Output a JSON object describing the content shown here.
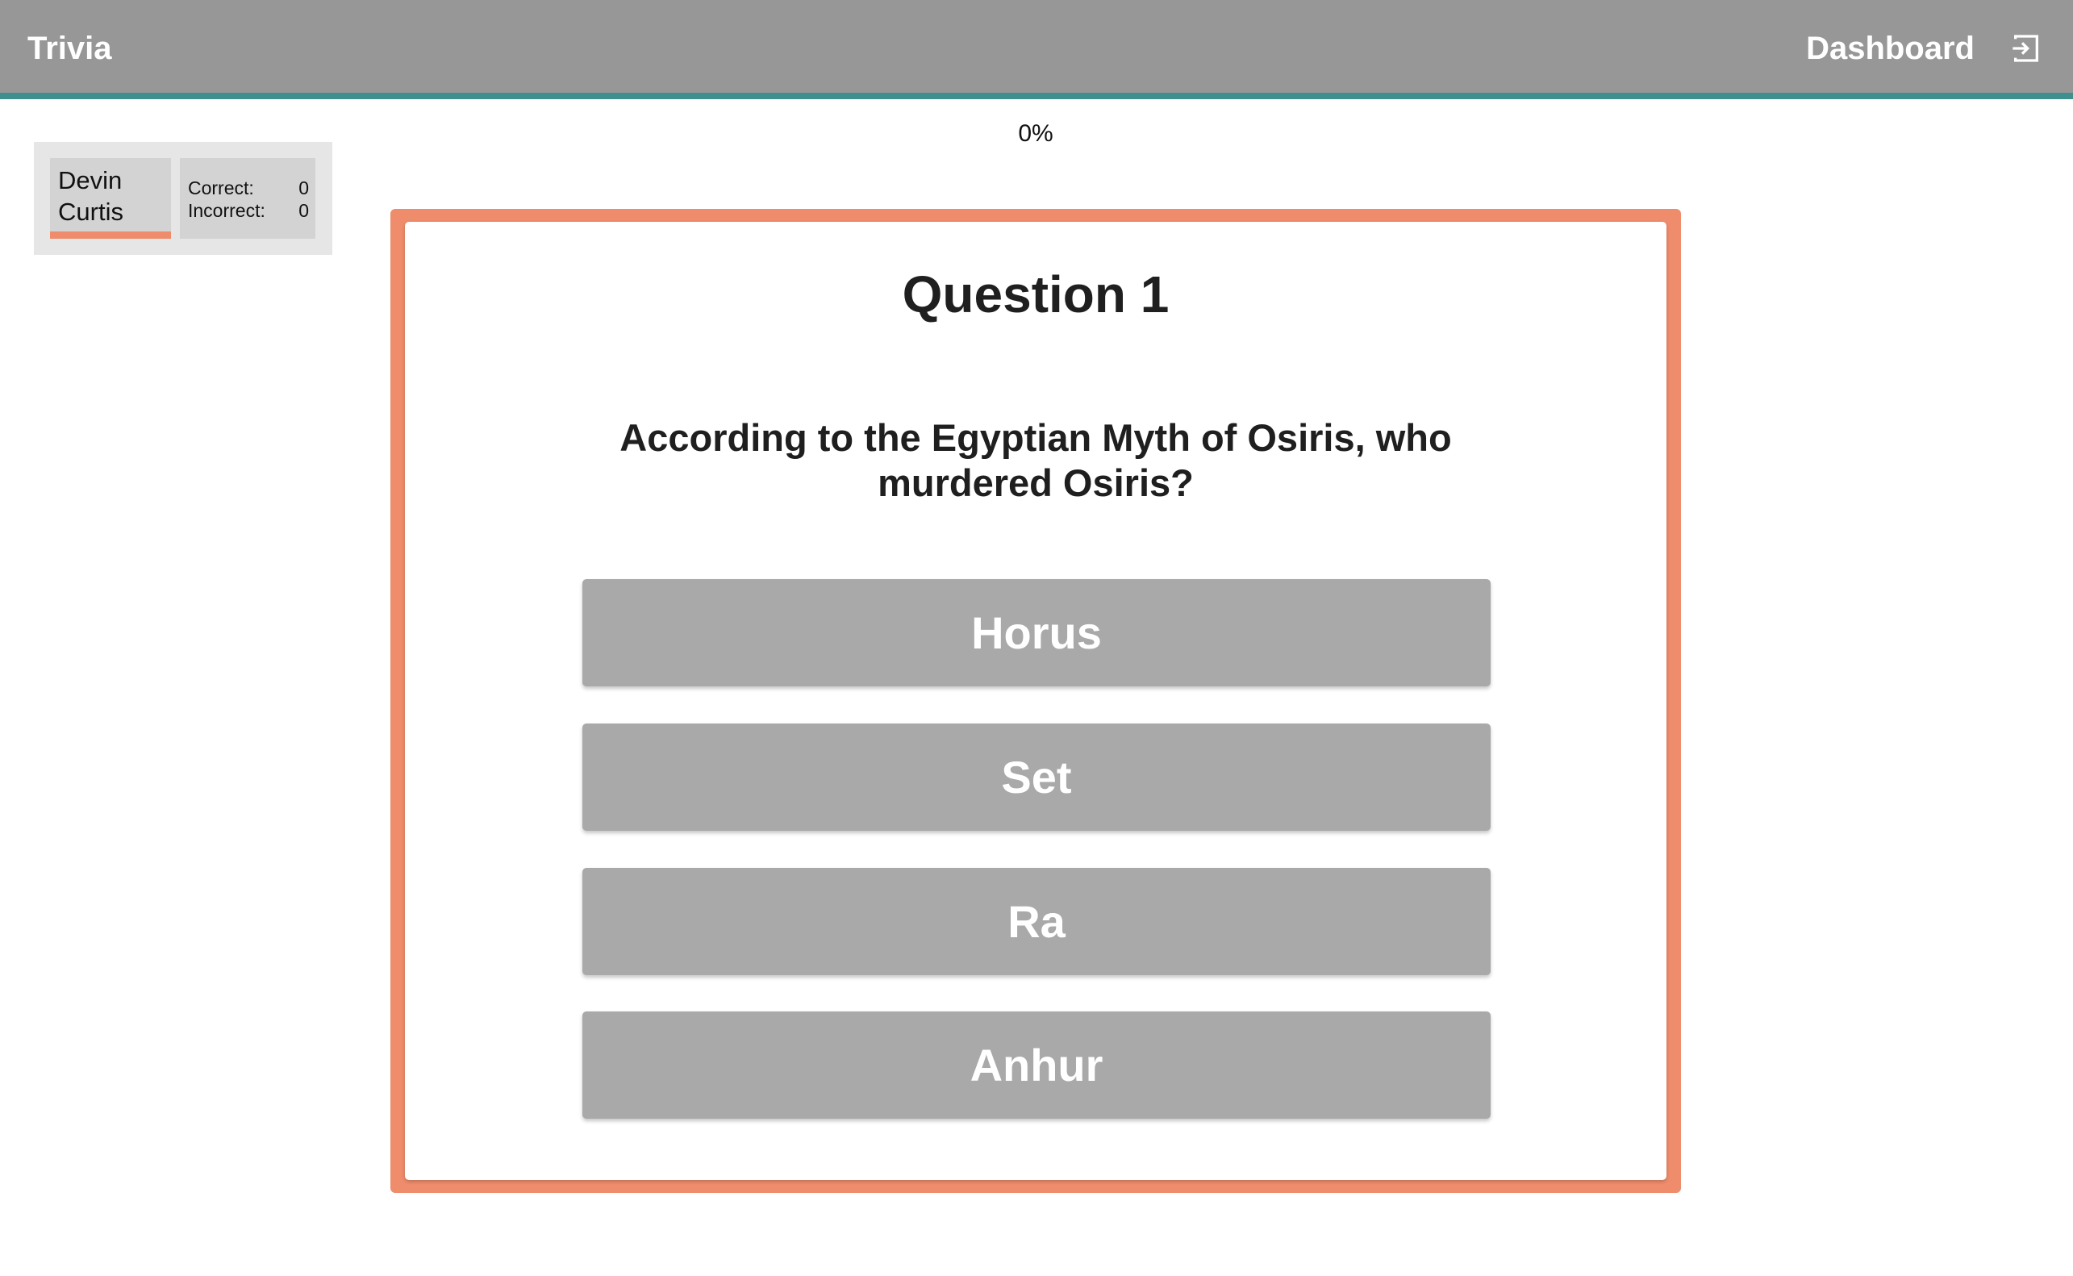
{
  "header": {
    "brand": "Trivia",
    "dashboard_label": "Dashboard",
    "logout_icon": "logout-icon"
  },
  "progress": {
    "label": "0%",
    "value": 0
  },
  "scoreboard": {
    "player_name": "Devin Curtis",
    "correct_label": "Correct:",
    "correct_value": "0",
    "incorrect_label": "Incorrect:",
    "incorrect_value": "0"
  },
  "question": {
    "title": "Question 1",
    "text": "According to the Egyptian Myth of Osiris, who murdered Osiris?",
    "answers": [
      "Horus",
      "Set",
      "Ra",
      "Anhur"
    ]
  },
  "colors": {
    "header_bg": "#979797",
    "header_accent": "#3f8f8e",
    "frame": "#ee8c6c",
    "answer_bg": "#a9a9a9",
    "score_card_bg": "#e6e6e6",
    "score_inner_bg": "#d3d3d3"
  }
}
